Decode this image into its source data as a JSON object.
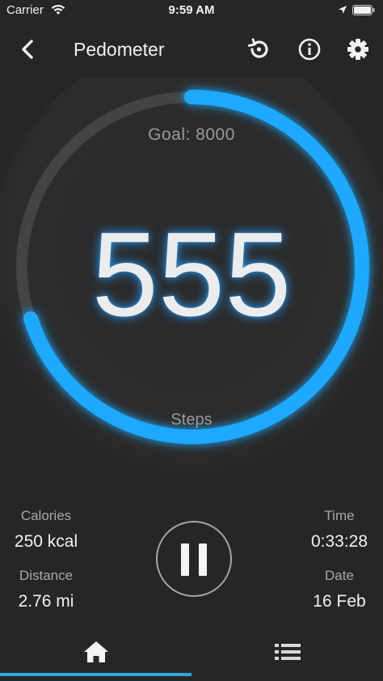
{
  "status_bar": {
    "carrier": "Carrier",
    "time": "9:59 AM"
  },
  "nav": {
    "title": "Pedometer"
  },
  "dial": {
    "goal_label": "Goal: 8000",
    "steps_value": "555",
    "steps_label": "Steps",
    "accent_color": "#1fa9ff"
  },
  "stats": {
    "calories_label": "Calories",
    "calories_value": "250 kcal",
    "distance_label": "Distance",
    "distance_value": "2.76 mi",
    "time_label": "Time",
    "time_value": "0:33:28",
    "date_label": "Date",
    "date_value": "16 Feb"
  },
  "tabs": {
    "active_color": "#2ea6e0"
  }
}
